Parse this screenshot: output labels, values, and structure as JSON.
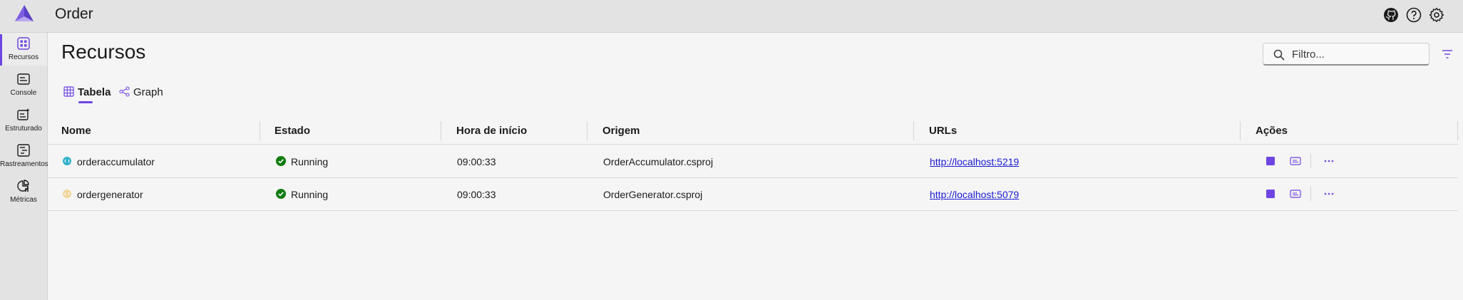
{
  "app": {
    "title": "Order"
  },
  "topbar": {
    "icons": [
      "github-icon",
      "help-icon",
      "settings-icon"
    ]
  },
  "sidebar": {
    "items": [
      {
        "label": "Recursos",
        "icon": "resources-icon",
        "active": true
      },
      {
        "label": "Console",
        "icon": "console-icon",
        "active": false
      },
      {
        "label": "Estruturado",
        "icon": "structured-logs-icon",
        "active": false
      },
      {
        "label": "Rastreamentos",
        "icon": "traces-icon",
        "active": false
      },
      {
        "label": "Métricas",
        "icon": "metrics-icon",
        "active": false
      }
    ]
  },
  "main": {
    "title": "Recursos",
    "search": {
      "placeholder": "Filtro...",
      "value": ""
    },
    "tabs": [
      {
        "label": "Tabela",
        "icon": "table-icon",
        "active": true
      },
      {
        "label": "Graph",
        "icon": "graph-icon",
        "active": false
      }
    ]
  },
  "table": {
    "headers": [
      "Nome",
      "Estado",
      "Hora de início",
      "Origem",
      "URLs",
      "Ações"
    ],
    "rows": [
      {
        "name": "orderaccumulator",
        "state": "Running",
        "start_time": "09:00:33",
        "source": "OrderAccumulator.csproj",
        "url": "http://localhost:5219",
        "icon_color": "#2bb0c9"
      },
      {
        "name": "ordergenerator",
        "state": "Running",
        "start_time": "09:00:33",
        "source": "OrderGenerator.csproj",
        "url": "http://localhost:5079",
        "icon_color": "#f3d59a"
      }
    ]
  },
  "colors": {
    "accent": "#6e45e2",
    "running": "#107c10",
    "link": "#1a1ad6"
  }
}
